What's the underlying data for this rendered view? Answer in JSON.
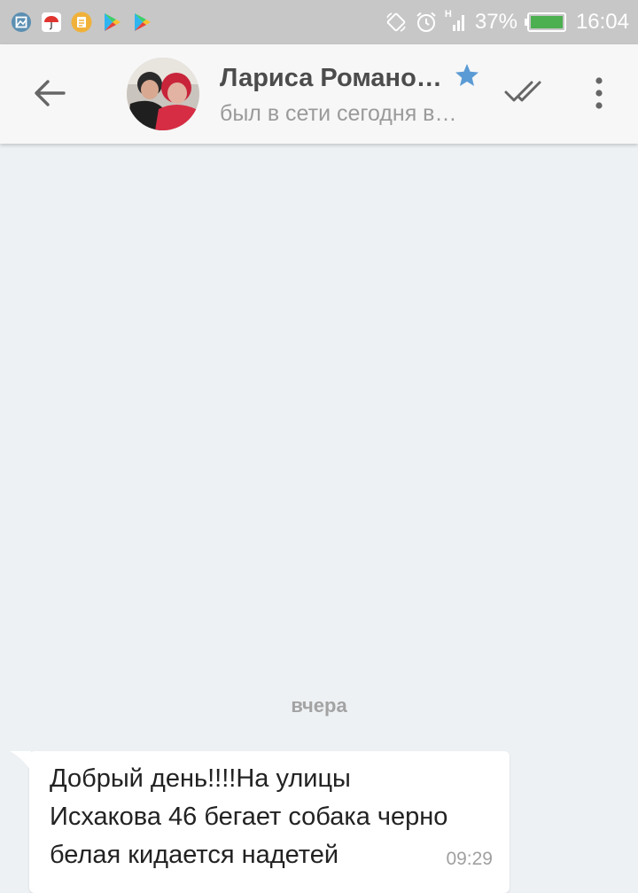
{
  "status_bar": {
    "battery_percent": "37%",
    "battery_level": 0.37,
    "time": "16:04",
    "network_label": "H",
    "notification_icons": [
      "gallery-icon",
      "umbrella-app-icon",
      "document-app-icon",
      "play-store-icon",
      "play-store-icon"
    ]
  },
  "header": {
    "contact_name": "Лариса Романо…",
    "contact_status": "был в сети сегодня в…",
    "icons": {
      "back": "arrow-left-icon",
      "favorite": "star-icon",
      "mark_read": "double-check-icon",
      "more": "more-vertical-icon"
    }
  },
  "chat": {
    "date_divider": "вчера",
    "messages": [
      {
        "text": "Добрый день!!!!На улицы\nИсхакова 46 бегает собака черно\nбелая кидается надетей",
        "time": "09:29"
      }
    ]
  },
  "colors": {
    "accent_star": "#5b9bd5",
    "chat_background": "#eef1f4",
    "header_background": "#f7f7f7",
    "status_bar": "#c7c7c7"
  }
}
